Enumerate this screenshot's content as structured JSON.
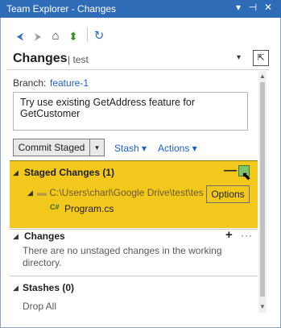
{
  "window": {
    "title": "Team Explorer - Changes",
    "controls": [
      "▾",
      "⊣",
      "✕"
    ]
  },
  "toolbar": {
    "icons": [
      "back-icon",
      "forward-icon",
      "home-icon",
      "plug-icon",
      "refresh-icon"
    ],
    "glyphs": [
      "⮜",
      "⮞",
      "⌂",
      "⬍",
      "↻"
    ]
  },
  "header": {
    "title": "Changes",
    "subtitle": "test",
    "menu_glyph": "▾",
    "nav_glyph": "⇱"
  },
  "branch": {
    "label": "Branch:",
    "value": "feature-1"
  },
  "commit_message": "Try use existing GetAddress feature for GetCustomer",
  "commit_button": {
    "label": "Commit Staged",
    "dropdown_glyph": "▾"
  },
  "links": {
    "stash": "Stash ▾",
    "actions": "Actions ▾"
  },
  "staged_changes": {
    "title": "Staged Changes (1)",
    "unstage_glyph": "—",
    "folder": "C:\\Users\\charl\\Google Drive\\test\\tes",
    "file_badge": "C#",
    "file": "Program.cs"
  },
  "tooltip": "Options",
  "changes": {
    "title": "Changes",
    "add_glyph": "+",
    "more_glyph": "···",
    "empty_text": "There are no unstaged changes in the working directory."
  },
  "stashes": {
    "title": "Stashes (0)",
    "drop_all": "Drop All"
  },
  "colors": {
    "titlebar": "#2f6cb8",
    "highlight": "#f2c81c",
    "link": "#1a62c7"
  }
}
